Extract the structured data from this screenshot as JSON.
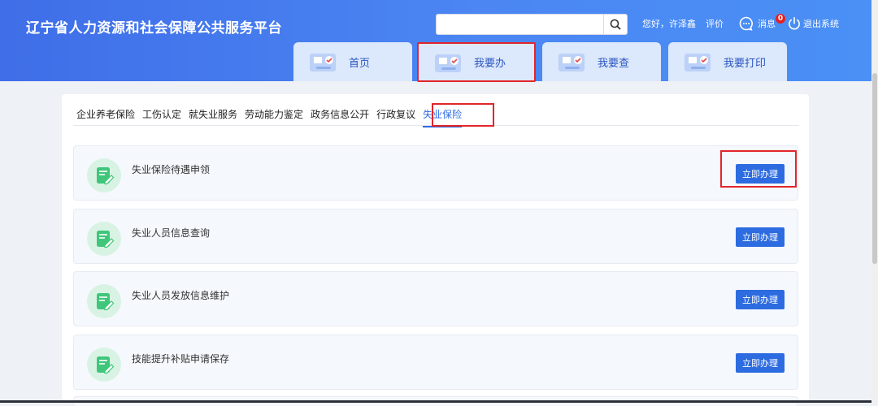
{
  "header": {
    "title": "辽宁省人力资源和社会保障公共服务平台",
    "search": {
      "value": "",
      "placeholder": ""
    },
    "greeting": "您好，许泽鑫",
    "evaluate_label": "评价",
    "messages_label": "消息",
    "message_count": "0",
    "logout_label": "退出系统"
  },
  "nav_tabs": [
    {
      "label": "首页"
    },
    {
      "label": "我要办"
    },
    {
      "label": "我要查"
    },
    {
      "label": "我要打印"
    }
  ],
  "sub_nav": [
    "企业养老保险",
    "工伤认定",
    "就失业服务",
    "劳动能力鉴定",
    "政务信息公开",
    "行政复议",
    "失业保险"
  ],
  "services": [
    {
      "name": "失业保险待遇申领",
      "button": "立即办理"
    },
    {
      "name": "失业人员信息查询",
      "button": "立即办理"
    },
    {
      "name": "失业人员发放信息维护",
      "button": "立即办理"
    },
    {
      "name": "技能提升补贴申请保存",
      "button": "立即办理"
    }
  ],
  "colors": {
    "header_blue": "#4a80f0",
    "tab_bg": "#dce8fb",
    "primary_button": "#2d6ce0",
    "highlight_red": "#e1262b",
    "service_icon_green": "#3fc67a"
  },
  "icons": [
    "search-icon",
    "message-icon",
    "power-icon",
    "tab-illustration-icon",
    "document-edit-icon"
  ]
}
